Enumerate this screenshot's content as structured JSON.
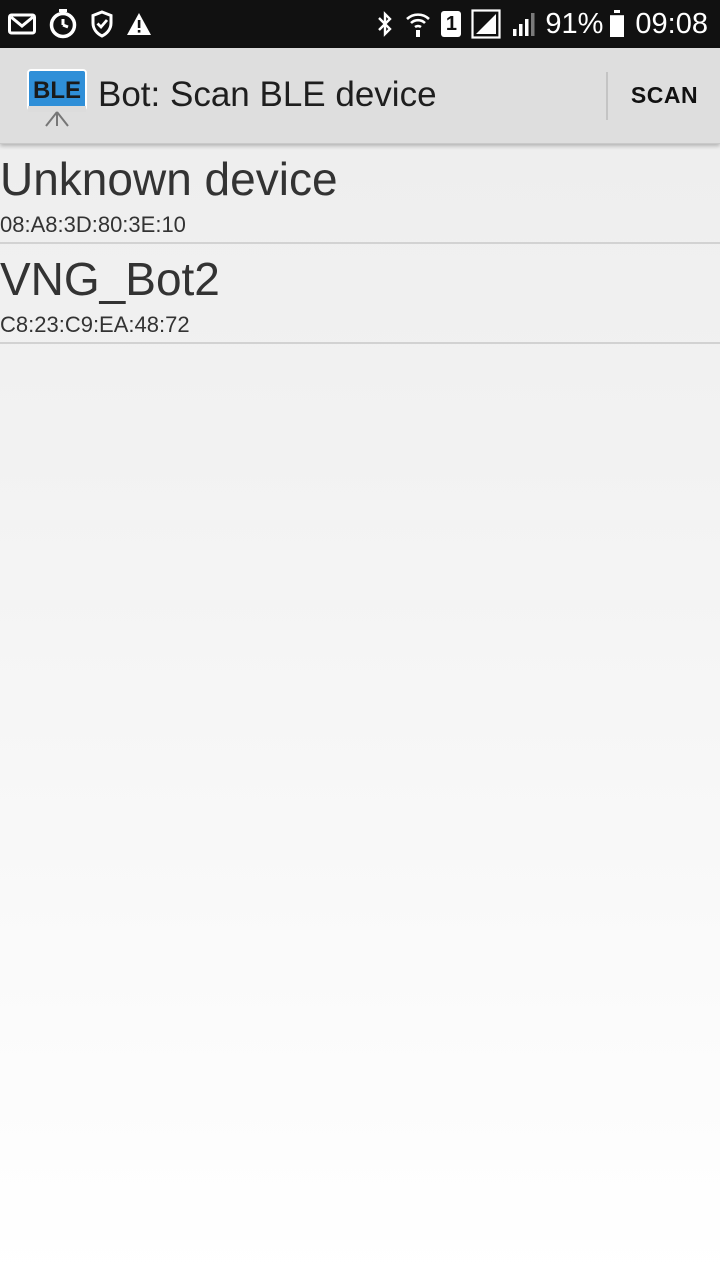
{
  "status_bar": {
    "left_icons": [
      "gmail-icon",
      "timer-icon",
      "shield-check-icon",
      "warning-icon"
    ],
    "right_icons": [
      "bluetooth-icon",
      "wifi-call-icon",
      "sim-1-icon",
      "signal-sim1-icon",
      "signal-sim2-icon",
      "battery-icon"
    ],
    "sim_label": "1",
    "battery_percent": "91%",
    "battery_level": 0.91,
    "time": "09:08"
  },
  "action_bar": {
    "app_icon_text": "BLE",
    "title": "Bot: Scan BLE device",
    "scan_label": "SCAN"
  },
  "devices": [
    {
      "name": "Unknown device",
      "address": "08:A8:3D:80:3E:10"
    },
    {
      "name": "VNG_Bot2",
      "address": "C8:23:C9:EA:48:72"
    }
  ],
  "colors": {
    "status_bar_bg": "#111111",
    "action_bar_bg": "#dedede",
    "app_icon_blue": "#2f8fd8"
  }
}
